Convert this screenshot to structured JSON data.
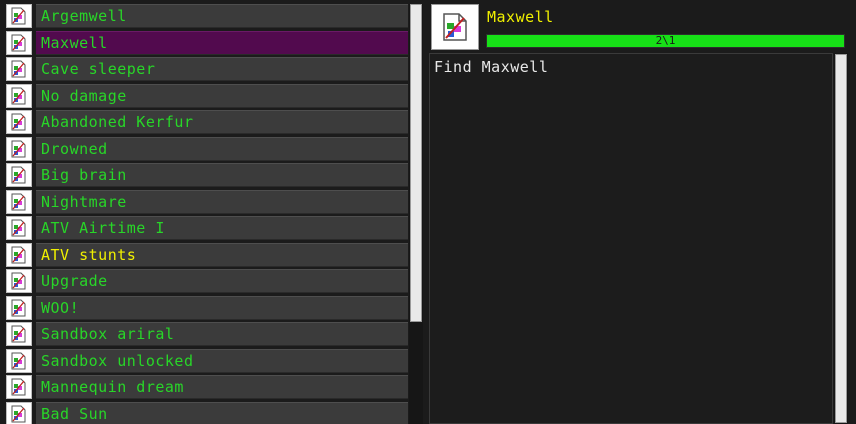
{
  "achievements": {
    "items": [
      {
        "label": "Argemwell",
        "icon": "broken-image-icon",
        "state": "normal"
      },
      {
        "label": "Maxwell",
        "icon": "broken-image-icon",
        "state": "selected"
      },
      {
        "label": "Cave sleeper",
        "icon": "broken-image-icon",
        "state": "normal"
      },
      {
        "label": "No damage",
        "icon": "broken-image-icon",
        "state": "normal"
      },
      {
        "label": "Abandoned Kerfur",
        "icon": "broken-image-icon",
        "state": "normal"
      },
      {
        "label": "Drowned",
        "icon": "broken-image-icon",
        "state": "normal"
      },
      {
        "label": "Big brain",
        "icon": "broken-image-icon",
        "state": "normal"
      },
      {
        "label": "Nightmare",
        "icon": "broken-image-icon",
        "state": "normal"
      },
      {
        "label": "ATV Airtime I",
        "icon": "broken-image-icon",
        "state": "normal"
      },
      {
        "label": "ATV stunts",
        "icon": "broken-image-icon",
        "state": "highlight"
      },
      {
        "label": "Upgrade",
        "icon": "broken-image-icon",
        "state": "normal"
      },
      {
        "label": "WOO!",
        "icon": "broken-image-icon",
        "state": "normal"
      },
      {
        "label": "Sandbox ariral",
        "icon": "broken-image-icon",
        "state": "normal"
      },
      {
        "label": "Sandbox unlocked",
        "icon": "broken-image-icon",
        "state": "normal"
      },
      {
        "label": "Mannequin dream",
        "icon": "broken-image-icon",
        "state": "normal"
      },
      {
        "label": "Bad Sun",
        "icon": "broken-image-icon",
        "state": "normal"
      }
    ]
  },
  "detail": {
    "title": "Maxwell",
    "progress_text": "2\\1",
    "progress_fraction": 1.0,
    "description": "Find Maxwell",
    "icon": "broken-image-icon"
  },
  "colors": {
    "text_green": "#28d628",
    "text_yellow": "#f0f000",
    "selected_row": "#520a4e",
    "progress_fill": "#17e017"
  }
}
